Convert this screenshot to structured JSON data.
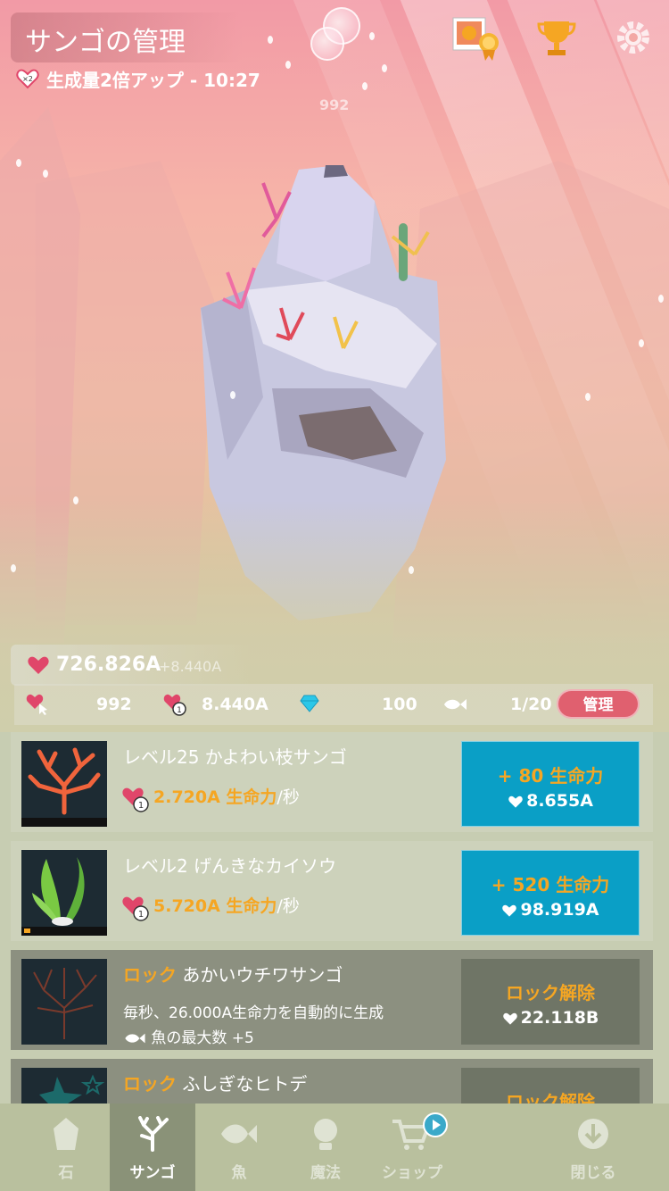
{
  "header": {
    "title": "サンゴの管理",
    "boost_badge": "×2",
    "boost_text": "生成量2倍アップ - 10:27",
    "floating_counter": "992"
  },
  "stats": {
    "life_total": "726.826A",
    "life_rate": "+8.440A",
    "taps": "992",
    "per_sec": "8.440A",
    "gems": "100",
    "fish": "1/20",
    "manage_label": "管理"
  },
  "items": [
    {
      "name": "レベル25 かよわい枝サンゴ",
      "rate": "2.720A 生命力",
      "per": "/秒",
      "buy_line1": "+ 80 生命力",
      "buy_line2": "8.655A",
      "thumb_color": "#f0643c",
      "progress": 0
    },
    {
      "name": "レベル2 げんきなカイソウ",
      "rate": "5.720A 生命力",
      "per": "/秒",
      "buy_line1": "+ 520 生命力",
      "buy_line2": "98.919A",
      "thumb_color": "#7ac943",
      "progress": 0.08
    },
    {
      "lock_word": "ロック",
      "name": "あかいウチワサンゴ",
      "desc": "毎秒、26.000A生命力を自動的に生成",
      "extra": "魚の最大数 +5",
      "buy_line1": "ロック解除",
      "buy_line2": "22.118B"
    },
    {
      "lock_word": "ロック",
      "name": "ふしぎなヒトデ",
      "buy_line1": "ロック解除"
    }
  ],
  "tabs": [
    {
      "label": "石",
      "icon": "stone-icon",
      "active": false
    },
    {
      "label": "サンゴ",
      "icon": "coral-icon",
      "active": true
    },
    {
      "label": "魚",
      "icon": "fish-icon",
      "active": false
    },
    {
      "label": "魔法",
      "icon": "magic-icon",
      "active": false
    },
    {
      "label": "ショップ",
      "icon": "cart-icon",
      "active": false
    },
    {
      "label": "閉じる",
      "icon": "close-down-icon",
      "active": false
    }
  ],
  "colors": {
    "accent_orange": "#f5a623",
    "buy_blue": "#0a9fc6",
    "manage_red": "#e0606f",
    "heart_pink": "#e0466a"
  }
}
